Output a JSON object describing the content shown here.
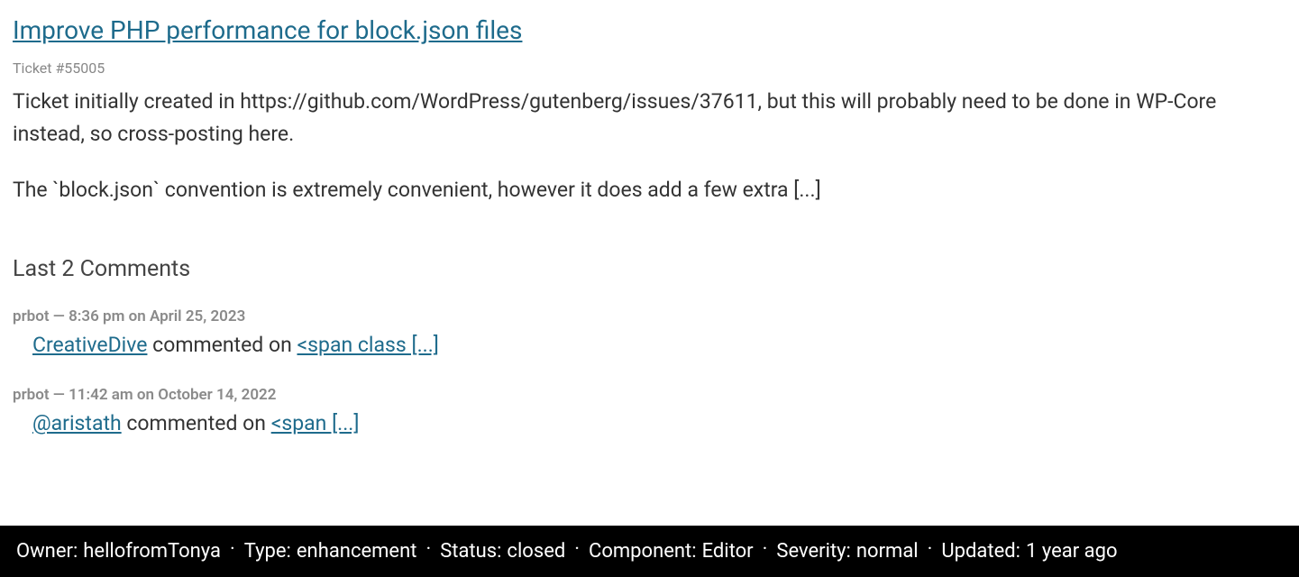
{
  "ticket": {
    "title": "Improve PHP performance for block.json files",
    "badge": "Ticket #55005",
    "description_p1": "Ticket initially created in https://github.com/WordPress/gutenberg/issues/37611, but this will probably need to be done in WP-Core instead, so cross-posting here.",
    "description_p2": "The `block.json` convention is extremely convenient, however it does add a few extra [...]"
  },
  "comments": {
    "heading": "Last 2 Comments",
    "list": [
      {
        "author": "prbot",
        "dash": " — ",
        "time": "8:36 pm on April 25, 2023",
        "user_link": "CreativeDive",
        "middle_text": " commented on ",
        "span_link": "<span class [...]"
      },
      {
        "author": "prbot",
        "dash": " — ",
        "time": "11:42 am on October 14, 2022",
        "user_link": "@aristath",
        "middle_text": " commented on ",
        "span_link": "<span [...]"
      }
    ]
  },
  "footer": {
    "sep": "·",
    "owner_label": "Owner:",
    "owner_value": "hellofromTonya",
    "type_label": "Type:",
    "type_value": "enhancement",
    "status_label": "Status:",
    "status_value": "closed",
    "component_label": "Component:",
    "component_value": "Editor",
    "severity_label": "Severity:",
    "severity_value": "normal",
    "updated_label": "Updated:",
    "updated_value": "1 year ago"
  }
}
